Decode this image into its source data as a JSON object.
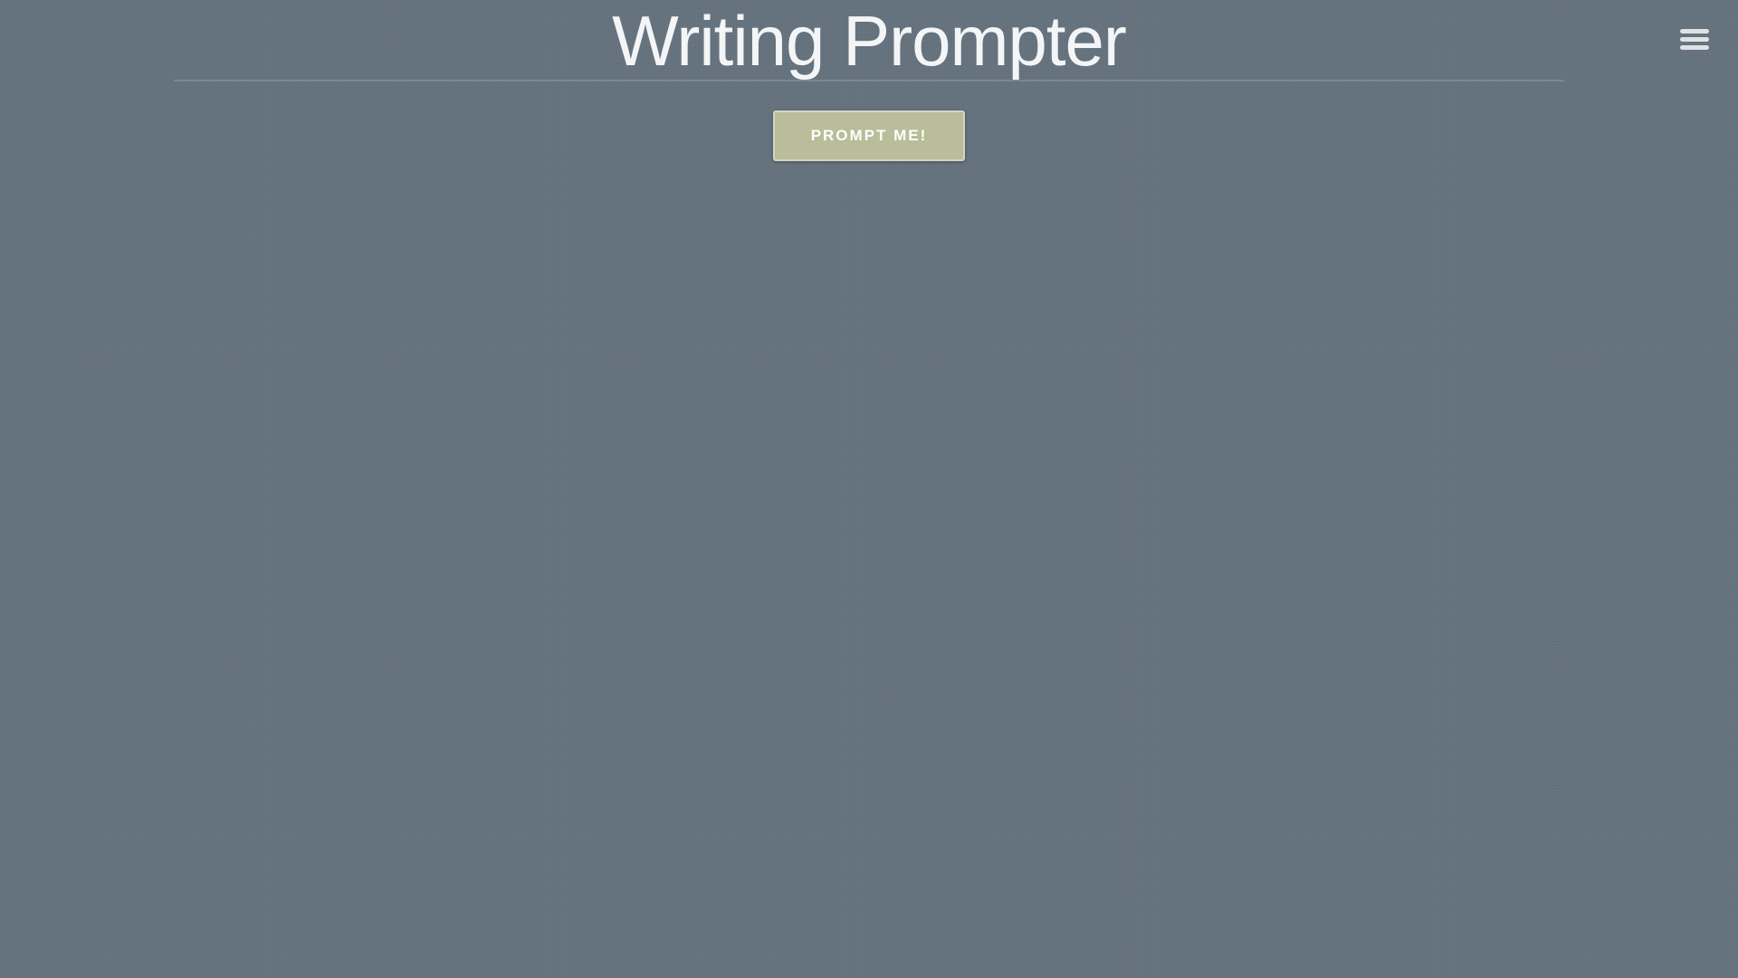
{
  "header": {
    "title": "Writing Prompter",
    "menu_icon": "hamburger-menu-icon"
  },
  "main": {
    "prompt_button_label": "PROMPT ME!"
  },
  "colors": {
    "background": "#65737f",
    "title_text": "#f4f5f7",
    "button_background": "#b9bd99",
    "button_text": "#ffffff",
    "menu_icon": "#dfe2e4"
  }
}
